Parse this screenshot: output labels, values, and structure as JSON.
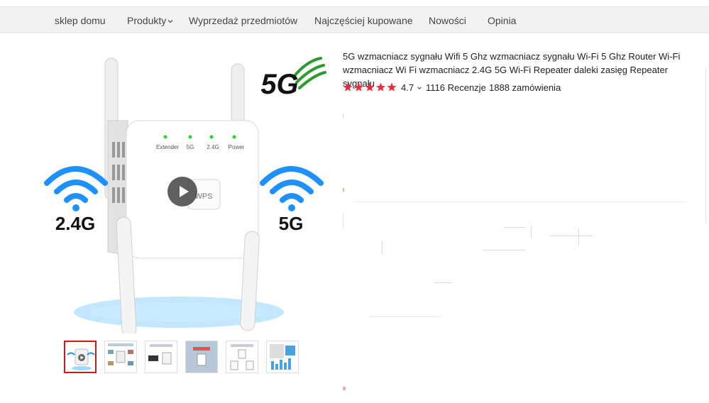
{
  "nav": {
    "items": [
      "sklep domu",
      "Produkty",
      "Wyprzedaż przedmiotów",
      "Najczęściej kupowane",
      "Nowości",
      "Opinia"
    ]
  },
  "gallery": {
    "hero_labels": {
      "brand_5g": "5G",
      "left_band": "2.4G",
      "right_band": "5G",
      "led_labels": [
        "Extender",
        "5G",
        "2.4G",
        "Power"
      ],
      "wps_label": "WPS"
    },
    "thumbnail_count": 6,
    "active_thumbnail": 1
  },
  "product": {
    "title": "5G wzmacniacz sygnału Wifi 5 Ghz wzmacniacz sygnału Wi-Fi 5 Ghz Router Wi-Fi wzmacniacz Wi Fi wzmacniacz 2.4G 5G Wi-Fi Repeater daleki zasięg Repeater sygnału",
    "rating": "4.7",
    "star_count": 5,
    "reviews": "1116 Recenzje",
    "orders": "1888 zamówienia"
  },
  "colors": {
    "star": "#e62e3f",
    "accent_red": "#c81a1a",
    "wifi_blue": "#1e90ff",
    "logo_green": "#2e9b2e",
    "nav_bg": "#f2f2f2"
  }
}
